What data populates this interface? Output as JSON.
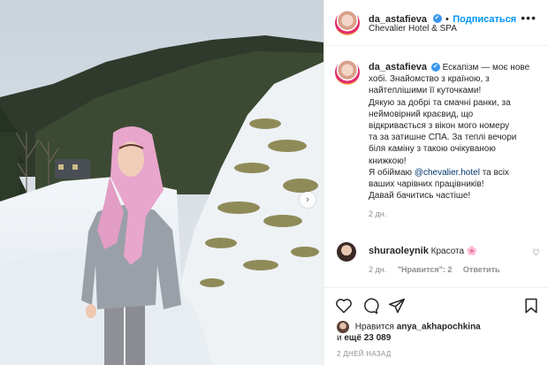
{
  "post": {
    "username": "da_astafieva",
    "follow_label": "Подписаться",
    "location": "Chevalier Hotel & SPA",
    "caption_lines": [
      "Ескапізм — моє нове",
      "хобі. Знайомство з країною, з",
      "найтеплішими її куточками!",
      "Дякую за добрі та смачні ранки, за",
      "неймовірний краєвид, що",
      "відкривається з вікон мого номеру",
      "та за затишне СПА. За теплі вечори",
      "біля каміну з такою очікуваною",
      "книжкою!",
      "Я обіймаю",
      "та всіх",
      "ваших чарівних працівників!",
      "Давай бачитись частіше!"
    ],
    "mention": "@chevalier.hotel",
    "caption_time": "2 дн.",
    "verified_mark": "✔"
  },
  "comment": {
    "username": "shuraoleynik",
    "text": "Красота",
    "emoji": "🌸",
    "time": "2 дн.",
    "likes_label": "\"Нравится\": 2",
    "reply_label": "Ответить"
  },
  "likes": {
    "prefix": "Нравится",
    "user": "anya_akhapochkina",
    "and_text": "и",
    "count_text": "ещё 23 089"
  },
  "posted_ago": "2 ДНЕЙ НАЗАД",
  "icons": {
    "more": "•••",
    "next": "›",
    "heart_small": "♡"
  },
  "colors": {
    "accent_blue": "#0095f6",
    "verified_blue": "#3897f0",
    "muted_text": "#8e8e8e",
    "link_blue": "#00376b"
  }
}
